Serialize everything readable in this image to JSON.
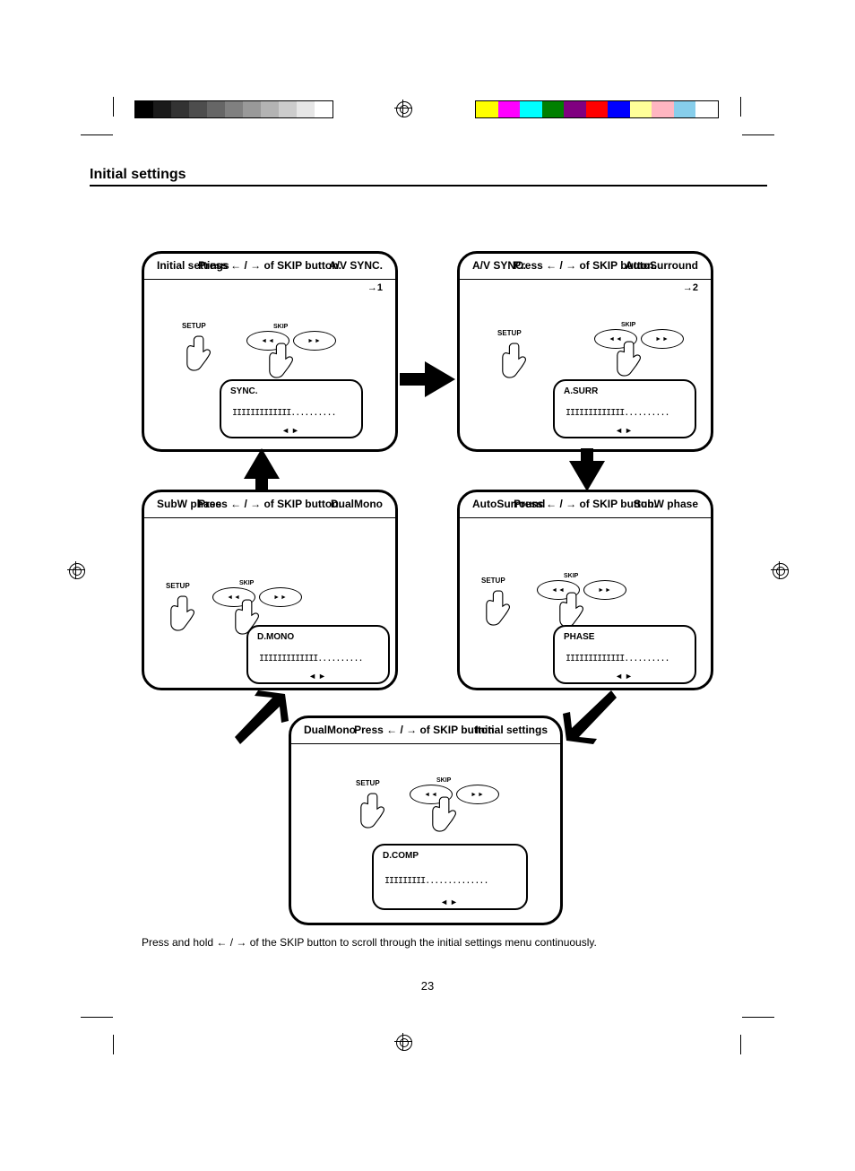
{
  "page_number": "23",
  "section_title": "Initial settings",
  "footer_note": "Press and hold ← / → of the SKIP button to scroll through the initial settings menu continuously.",
  "panels": {
    "p1": {
      "header_left": "Initial settings",
      "header_mid": "Press ← / → of SKIP button.",
      "header_right": "A/V SYNC.",
      "line2": "→1",
      "lcd_label": "SYNC.",
      "lcd_scale_pre": "IIIIIIIIIIIII",
      "lcd_scale_post": "..........",
      "lcd_lr": "◄►"
    },
    "p2": {
      "header_left": "A/V SYNC.",
      "header_mid": "Press ← / → of SKIP button.",
      "header_right": "AutoSurround",
      "line2": "→2",
      "lcd_label": "A.SURR",
      "lcd_scale_pre": "IIIIIIIIIIIII",
      "lcd_scale_post": "..........",
      "lcd_lr": "◄►"
    },
    "p3": {
      "header_left": "SubW phase",
      "header_mid": "Press ← / → of SKIP button.",
      "header_right": "DualMono",
      "lcd_label": "D.MONO",
      "lcd_scale_pre": "IIIIIIIIIIIII",
      "lcd_scale_post": "..........",
      "lcd_lr": "◄►"
    },
    "p4": {
      "header_left": "AutoSurround",
      "header_mid": "Press ← / → of SKIP button.",
      "header_right": "SubW phase",
      "lcd_label": "PHASE",
      "lcd_scale_pre": "IIIIIIIIIIIII",
      "lcd_scale_post": "..........",
      "lcd_lr": "◄►"
    },
    "p5": {
      "header_left": "DualMono",
      "header_mid": "Press ← / → of SKIP button.",
      "header_right": "Initial settings",
      "lcd_label": "D.COMP",
      "lcd_scale_pre": "IIIIIIIII",
      "lcd_scale_post": "..............",
      "lcd_lr": "◄►"
    }
  },
  "colorbar_gray": [
    "#000000",
    "#1a1a1a",
    "#333333",
    "#4d4d4d",
    "#666666",
    "#808080",
    "#999999",
    "#b3b3b3",
    "#cccccc",
    "#e6e6e6",
    "#ffffff"
  ],
  "colorbar_color": [
    "#ffff00",
    "#ff00ff",
    "#00ffff",
    "#008000",
    "#800080",
    "#ff0000",
    "#0000ff",
    "#ffff99",
    "#ffb6c1",
    "#87ceeb",
    "#ffffff"
  ]
}
